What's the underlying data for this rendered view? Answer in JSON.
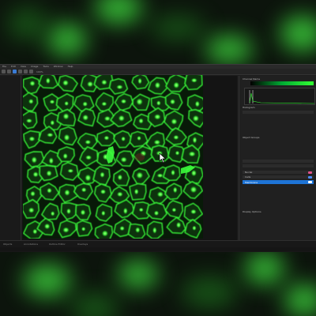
{
  "menu": {
    "items": [
      "File",
      "Edit",
      "View",
      "Image",
      "Tools",
      "Window",
      "Help"
    ]
  },
  "toolbar": {
    "zoom_text": "100%"
  },
  "right_panel": {
    "channel_header": "Channel Name",
    "histogram_header": "Histogram",
    "object_header": "Object Groups",
    "display_header": "Display Options",
    "layers": [
      {
        "label": "Nuclei",
        "color": "#e0508a"
      },
      {
        "label": "Cells",
        "color": "#4a8cff"
      },
      {
        "label": "Membrane",
        "color": "#ffffff",
        "selected": true
      }
    ]
  },
  "status": {
    "tabs": [
      "Objects",
      "Annotations",
      "Outline Editor",
      "Overlays"
    ]
  },
  "colors": {
    "accent": "#1e74d6",
    "fluor": "#3cff3c"
  }
}
